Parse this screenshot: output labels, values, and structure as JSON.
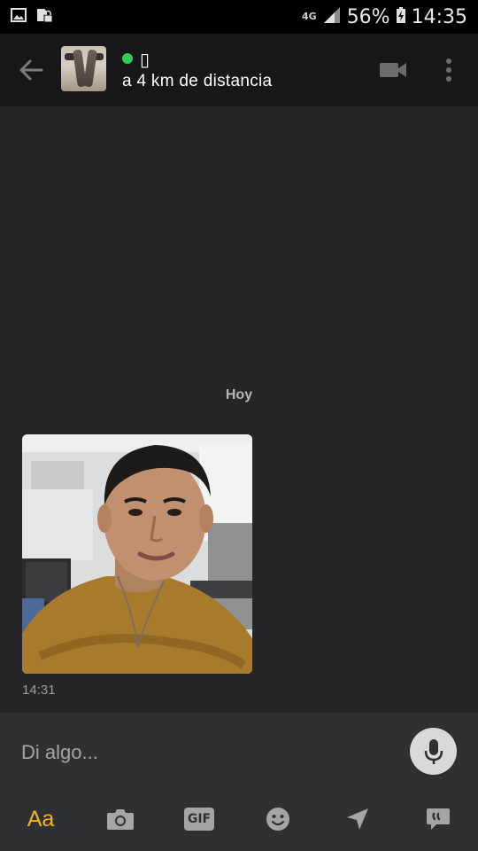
{
  "status_bar": {
    "network": "4G",
    "battery": "56%",
    "time": "14:35"
  },
  "header": {
    "contact_name": "▯",
    "distance": "a 4 km de distancia",
    "online": true
  },
  "chat": {
    "day_label": "Hoy",
    "messages": [
      {
        "type": "photo",
        "time": "14:31"
      }
    ]
  },
  "composer": {
    "placeholder": "Di algo..."
  },
  "toolbar": {
    "text_label": "Aa",
    "gif_label": "GIF"
  },
  "colors": {
    "accent": "#f5b516",
    "online": "#2ecc5a",
    "background": "#242528",
    "header": "#17171a",
    "composer": "#2d3035"
  },
  "icons": [
    "back-arrow-icon",
    "video-camera-icon",
    "more-vert-icon",
    "microphone-icon",
    "camera-icon",
    "gif-icon",
    "emoji-icon",
    "location-icon",
    "saved-phrases-icon"
  ]
}
